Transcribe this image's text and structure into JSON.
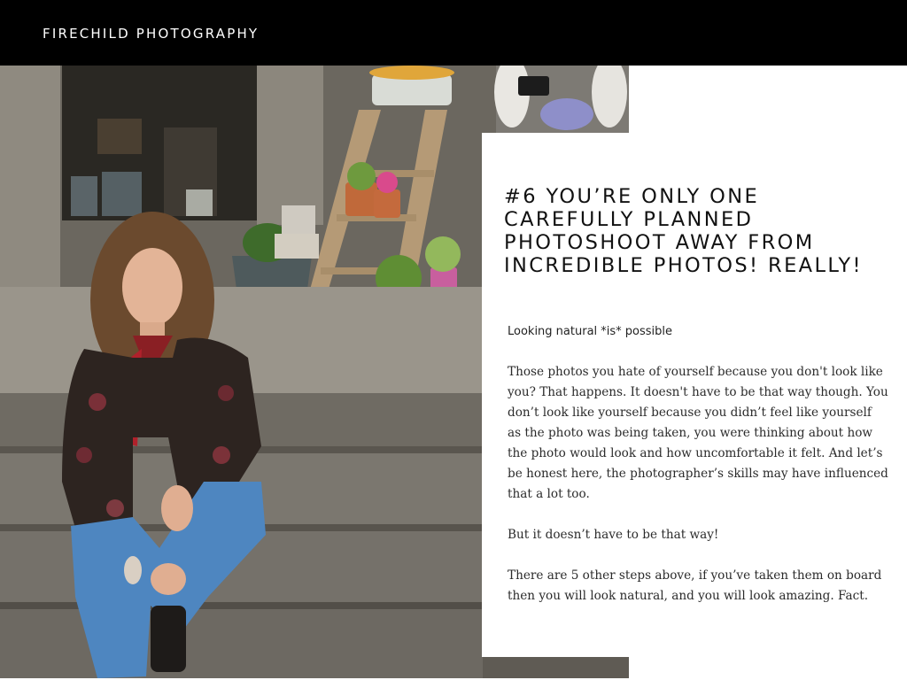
{
  "header": {
    "brand": "FIRECHILD PHOTOGRAPHY"
  },
  "photo": {
    "subject": "woman-sitting-on-stone-steps"
  },
  "card": {
    "title": "#6 YOU’RE ONLY ONE CAREFULLY PLANNED PHOTOSHOOT AWAY FROM INCREDIBLE PHOTOS! REALLY!",
    "subtitle": "Looking natural *is* possible",
    "paragraphs": [
      "Those photos you hate of yourself because you don't look like you? That happens. It doesn't have to be that way though. You don’t look like yourself because you didn’t feel like yourself as the photo was being taken, you were thinking about how the photo would look and how uncomfortable it felt. And let’s be honest here, the photographer’s skills may have influenced that a lot too.",
      "But it doesn’t have to be that way!",
      "There are 5 other steps above, if you’ve taken them on board then you will look natural, and you will look amazing. Fact."
    ]
  },
  "colors": {
    "header_bg": "#000000",
    "brand_text": "#ffffff",
    "card_bg": "#ffffff",
    "body_text": "#2b2b2b"
  }
}
